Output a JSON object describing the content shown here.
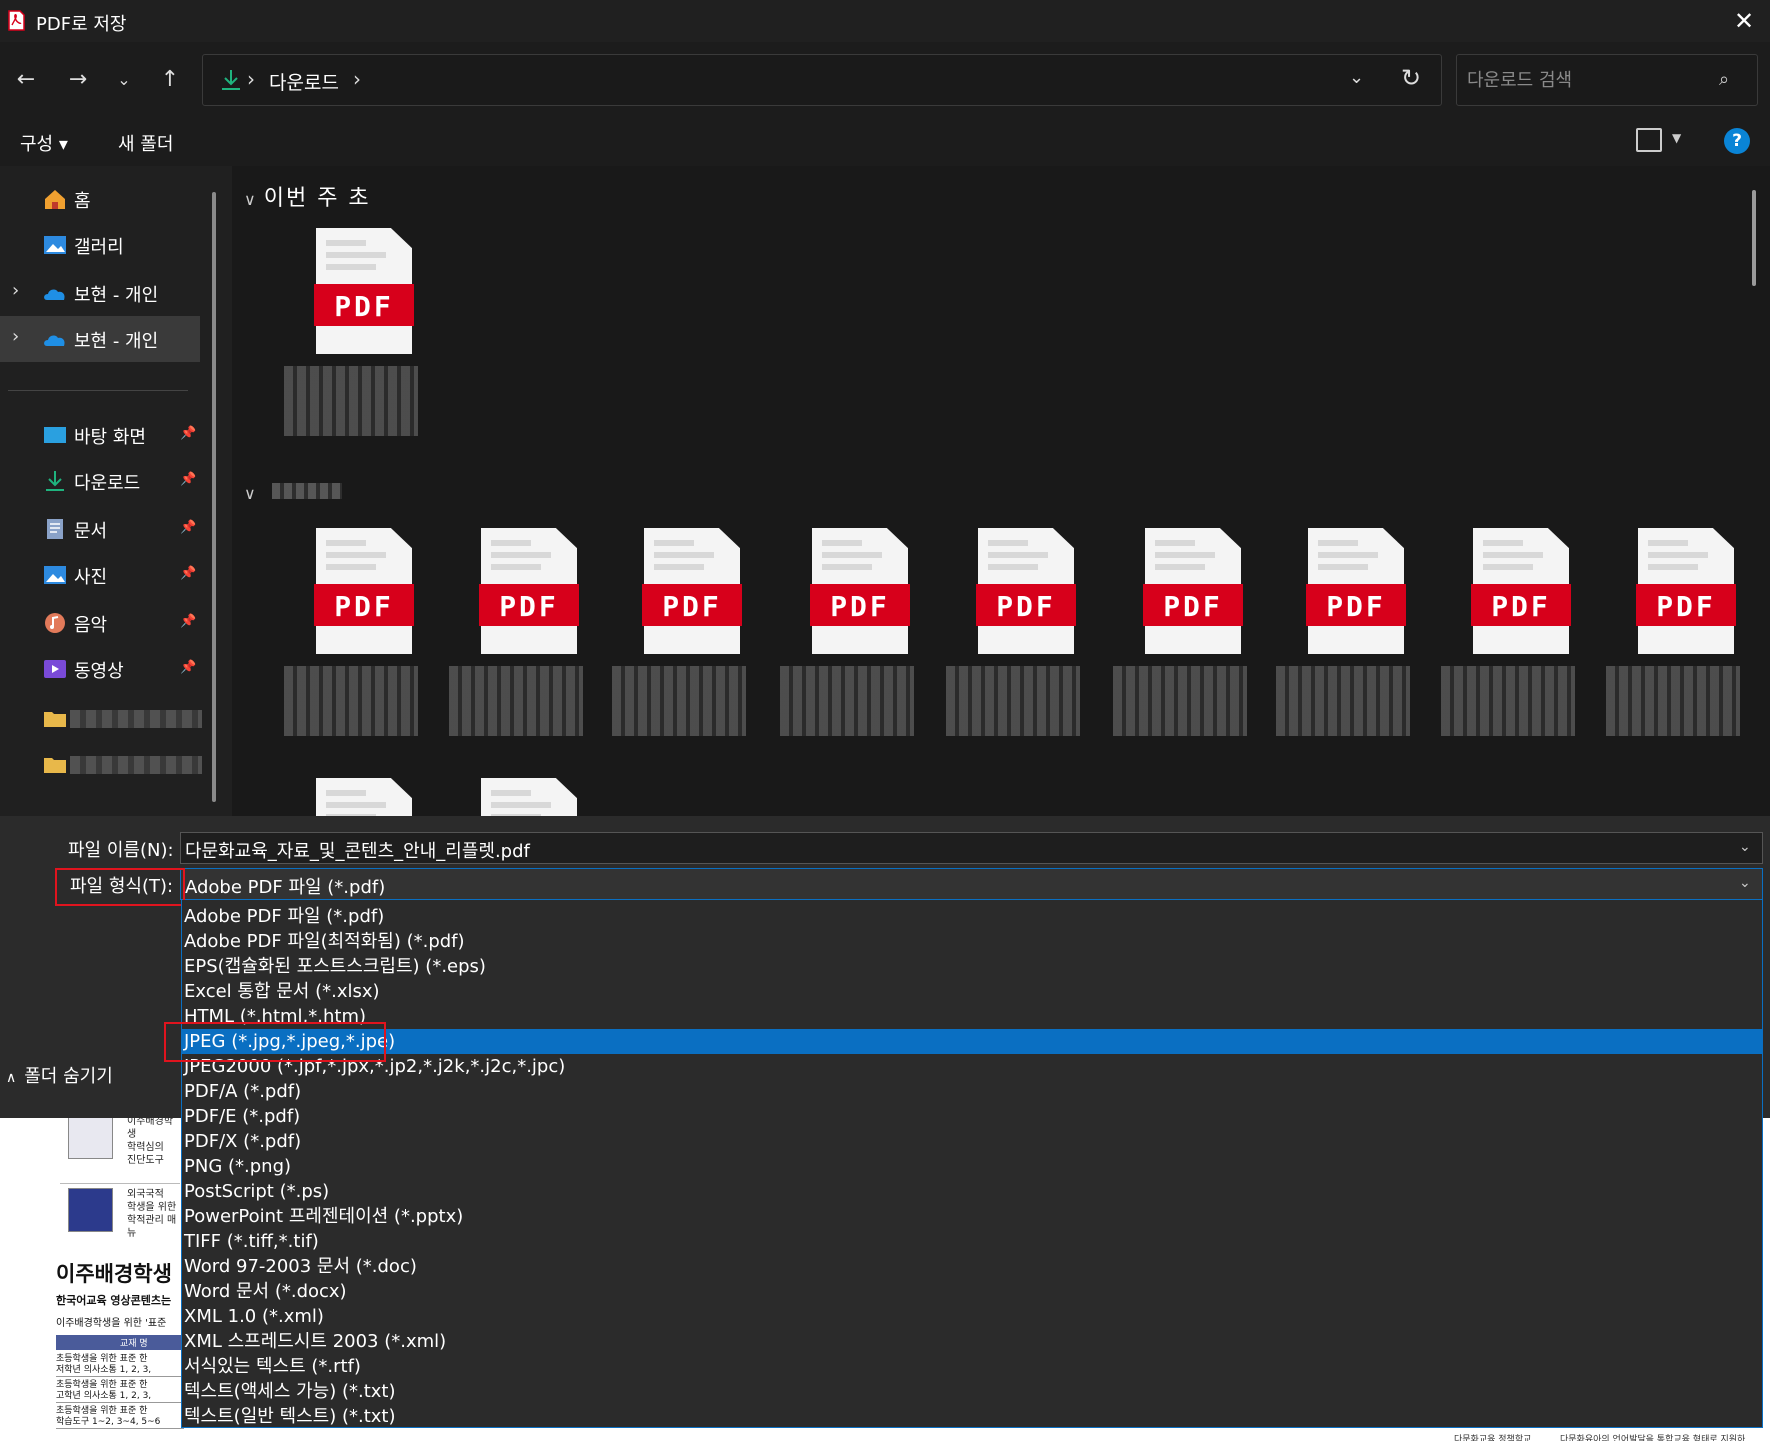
{
  "window": {
    "title": "PDF로 저장"
  },
  "nav": {
    "breadcrumb": "다운로드",
    "search_placeholder": "다운로드 검색"
  },
  "toolbar": {
    "organize": "구성 ▾",
    "new_folder": "새 폴더",
    "help": "?"
  },
  "sidebar": {
    "items": [
      {
        "label": "홈"
      },
      {
        "label": "갤러리"
      },
      {
        "label": "보현 - 개인"
      },
      {
        "label": "보현 - 개인"
      },
      {
        "label": "바탕 화면"
      },
      {
        "label": "다운로드"
      },
      {
        "label": "문서"
      },
      {
        "label": "사진"
      },
      {
        "label": "음악"
      },
      {
        "label": "동영상"
      }
    ]
  },
  "content": {
    "group1": "이번 주 초",
    "pdf_label": "PDF"
  },
  "bottom": {
    "filename_label": "파일 이름(N):",
    "filename_value": "다문화교육_자료_및_콘텐츠_안내_리플렛.pdf",
    "filetype_label": "파일 형식(T):",
    "filetype_value": "Adobe PDF 파일 (*.pdf)",
    "hide_folders": "폴더 숨기기"
  },
  "filetype_options": [
    "Adobe PDF 파일 (*.pdf)",
    "Adobe PDF 파일(최적화됨) (*.pdf)",
    "EPS(캡슐화된 포스트스크립트) (*.eps)",
    "Excel 통합 문서 (*.xlsx)",
    "HTML (*.html,*.htm)",
    "JPEG (*.jpg,*.jpeg,*.jpe)",
    "JPEG2000 (*.jpf,*.jpx,*.jp2,*.j2k,*.j2c,*.jpc)",
    "PDF/A (*.pdf)",
    "PDF/E (*.pdf)",
    "PDF/X (*.pdf)",
    "PNG (*.png)",
    "PostScript (*.ps)",
    "PowerPoint 프레젠테이션 (*.pptx)",
    "TIFF (*.tiff,*.tif)",
    "Word 97-2003 문서 (*.doc)",
    "Word 문서 (*.docx)",
    "XML 1.0 (*.xml)",
    "XML 스프레드시트 2003 (*.xml)",
    "서식있는 텍스트 (*.rtf)",
    "텍스트(액세스 가능) (*.txt)",
    "텍스트(일반 텍스트) (*.txt)"
  ],
  "highlighted_option": "JPEG (*.jpg,*.jpeg,*.jpe)",
  "background_doc": {
    "row1": [
      "이주배경학생",
      "학력심의",
      "진단도구"
    ],
    "row2": [
      "외국국적",
      "학생을 위한",
      "학적관리 매뉴"
    ],
    "heading": "이주배경학생",
    "sub1": "한국어교육 영상콘텐츠는",
    "sub2": "이주배경학생을 위한 '표준",
    "table_header": "교재 명",
    "table_rows": [
      [
        "초등학생을 위한 표준 한",
        "저학년 의사소통 1, 2, 3,"
      ],
      [
        "초등학생을 위한 표준 한",
        "고학년 의사소통 1, 2, 3,"
      ],
      [
        "초등학생을 위한 표준 한",
        "학습도구 1~2, 3~4, 5~6"
      ]
    ],
    "footer1": "다문화교육 정책학교",
    "footer2": "다문화유아의 언어발달을 통합교육 형태로 지원하"
  },
  "colors": {
    "accent": "#0a6fc2",
    "highlight_box": "#e0141e",
    "pdf_red": "#d7001b"
  }
}
